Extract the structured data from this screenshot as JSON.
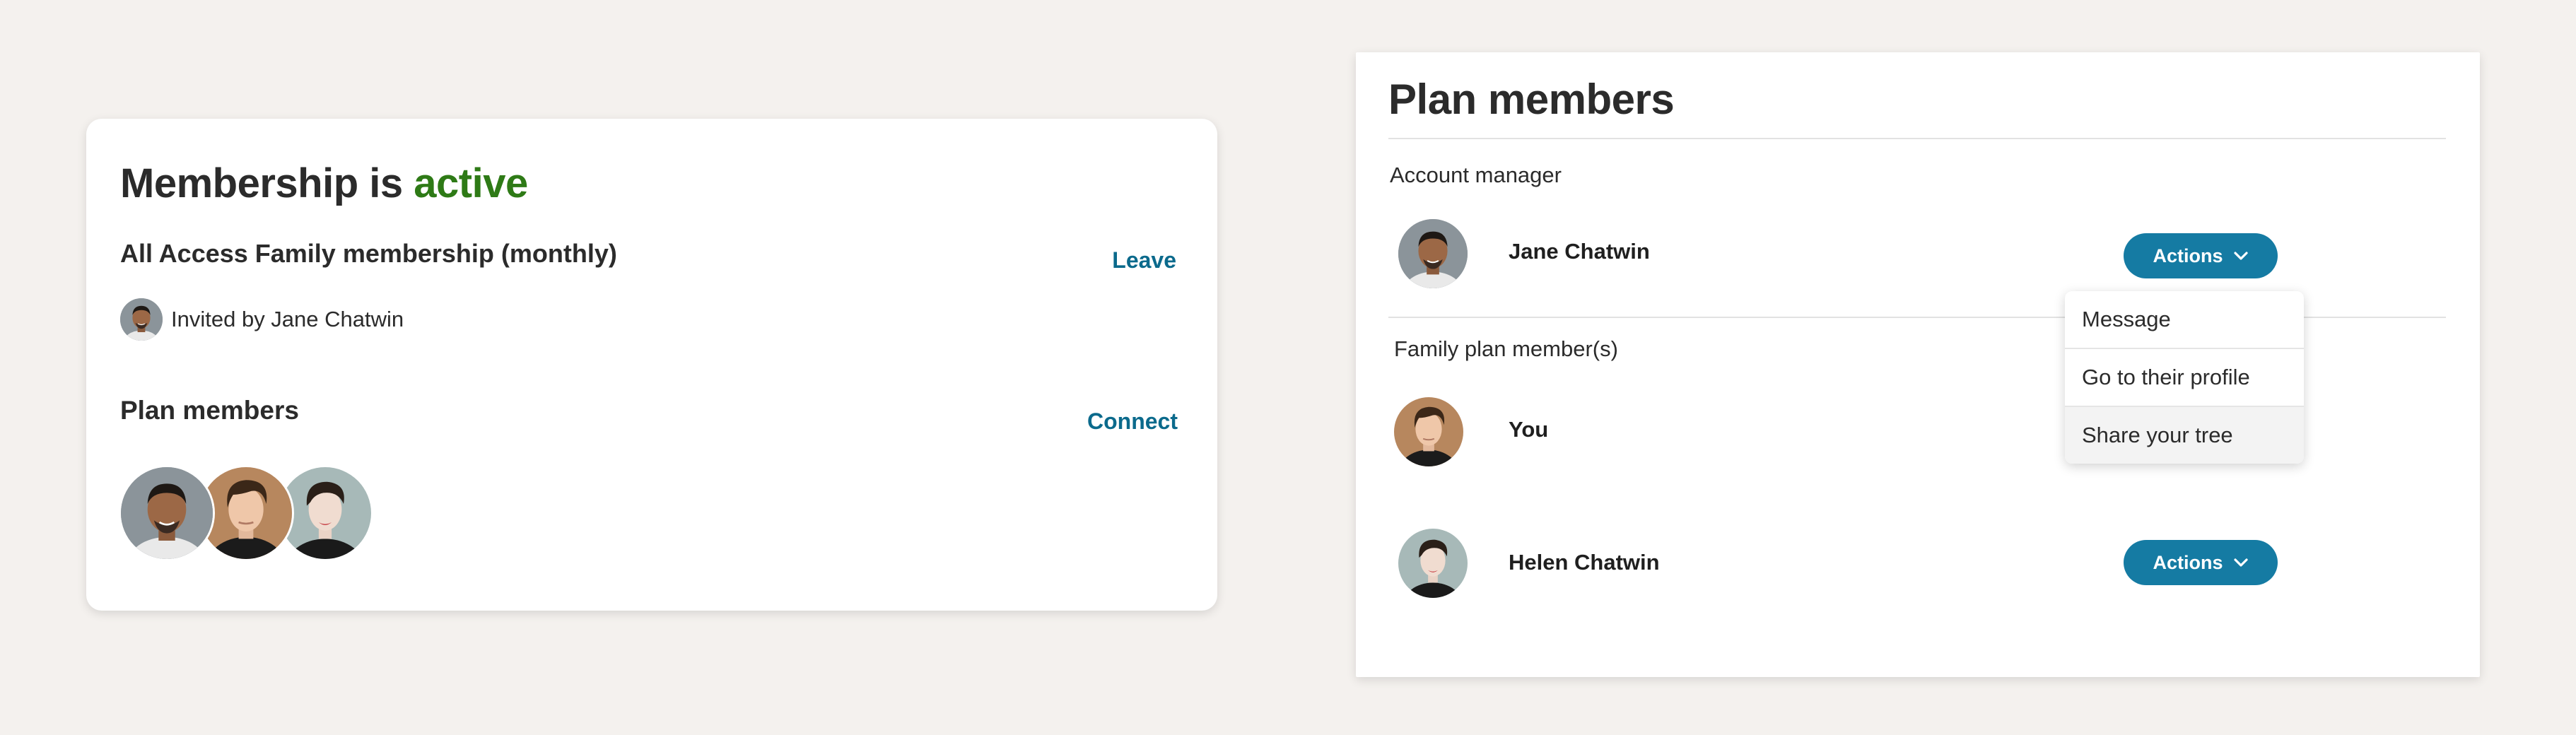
{
  "membership_card": {
    "title_prefix": "Membership is",
    "title_status": "active",
    "status_color": "#2e7a16",
    "plan_name": "All Access Family membership (monthly)",
    "leave_label": "Leave",
    "invited_text": "Invited by Jane Chatwin",
    "plan_members_label": "Plan members",
    "connect_label": "Connect",
    "member_avatars": [
      "jane-chatwin-avatar",
      "you-avatar",
      "helen-chatwin-avatar"
    ]
  },
  "plan_panel": {
    "title": "Plan members",
    "account_manager_label": "Account manager",
    "family_members_label": "Family plan member(s)",
    "members": [
      {
        "name": "Jane Chatwin",
        "actions_label": "Actions"
      },
      {
        "name": "You"
      },
      {
        "name": "Helen Chatwin",
        "actions_label": "Actions"
      }
    ],
    "dropdown": {
      "items": [
        "Message",
        "Go to their profile",
        "Share your tree"
      ],
      "highlighted": "Share your tree"
    }
  },
  "colors": {
    "accent": "#157ba3",
    "link": "#0b6a8c",
    "background": "#f4f1ee"
  }
}
